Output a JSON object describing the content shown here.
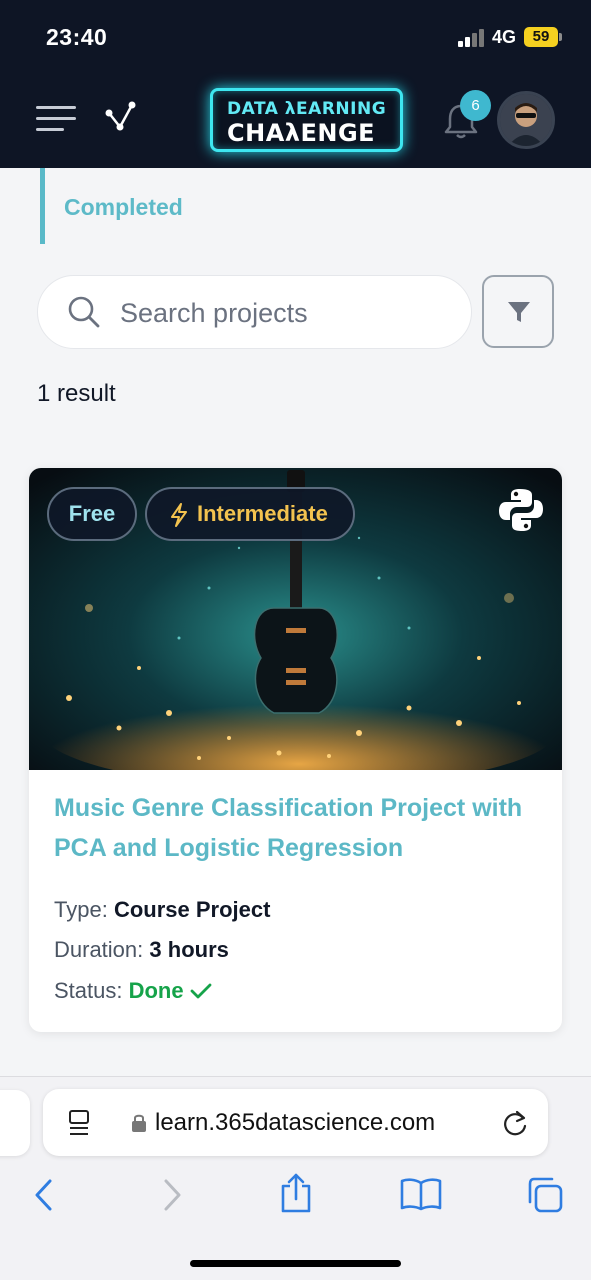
{
  "status_bar": {
    "time": "23:40",
    "network": "4G",
    "battery": "59"
  },
  "header": {
    "logo_line1": "DATA λEARNING",
    "logo_line2": "CHAλENGE",
    "notification_count": "6"
  },
  "tabs": {
    "active_label": "Completed"
  },
  "search": {
    "placeholder": "Search projects",
    "value": ""
  },
  "results": {
    "count_text": "1 result"
  },
  "project": {
    "badge_price": "Free",
    "badge_level": "Intermediate",
    "title": "Music Genre Classification Project with PCA and Logistic Regression",
    "type_label": "Type:",
    "type_value": "Course Project",
    "duration_label": "Duration:",
    "duration_value": "3 hours",
    "status_label": "Status:",
    "status_value": "Done",
    "language_icon": "python-icon"
  },
  "browser": {
    "url": "learn.365datascience.com"
  },
  "colors": {
    "accent": "#5cb8c6",
    "header_bg": "#0e1525",
    "done": "#16a34a",
    "level": "#f3c34f"
  }
}
